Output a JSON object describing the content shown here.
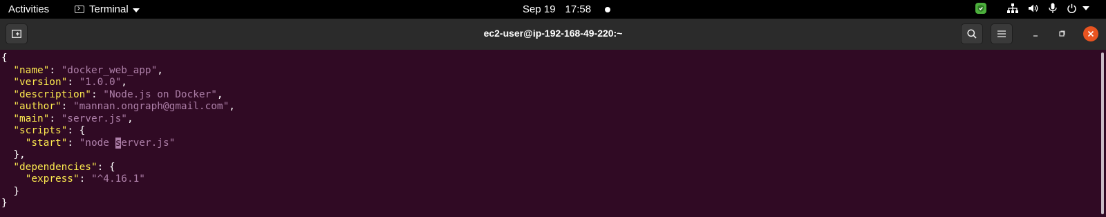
{
  "topbar": {
    "activities": "Activities",
    "app_name": "Terminal",
    "date": "Sep 19",
    "time": "17:58",
    "status_icons": [
      "shield-check-icon",
      "network-icon",
      "volume-icon",
      "microphone-icon",
      "power-icon"
    ]
  },
  "window": {
    "title": "ec2-user@ip-192-168-49-220:~",
    "buttons": [
      "new-tab-icon",
      "search-icon",
      "hamburger-menu-icon",
      "minimize-icon",
      "maximize-icon",
      "close-icon"
    ]
  },
  "colors": {
    "terminal_bg": "#300a24",
    "key": "#fce94f",
    "string": "#ad7fa8",
    "close_button": "#e95420",
    "shield": "#4caf3c"
  },
  "terminal": {
    "l1_open": "{",
    "name": {
      "indent": "  ",
      "key": "\"name\"",
      "sep": ": ",
      "value": "\"docker_web_app\"",
      "end": ","
    },
    "version": {
      "indent": "  ",
      "key": "\"version\"",
      "sep": ": ",
      "value": "\"1.0.0\"",
      "end": ","
    },
    "description": {
      "indent": "  ",
      "key": "\"description\"",
      "sep": ": ",
      "value": "\"Node.js on Docker\"",
      "end": ","
    },
    "author": {
      "indent": "  ",
      "key": "\"author\"",
      "sep": ": ",
      "value": "\"mannan.ongraph@gmail.com\"",
      "end": ","
    },
    "main": {
      "indent": "  ",
      "key": "\"main\"",
      "sep": ": ",
      "value": "\"server.js\"",
      "end": ","
    },
    "scripts": {
      "indent": "  ",
      "key": "\"scripts\"",
      "sep": ": {"
    },
    "start": {
      "indent": "    ",
      "key": "\"start\"",
      "sep": ": ",
      "value_pre": "\"node ",
      "cursor_char": "s",
      "value_post": "erver.js\""
    },
    "scripts_close": "  },",
    "dependencies": {
      "indent": "  ",
      "key": "\"dependencies\"",
      "sep": ": {"
    },
    "express": {
      "indent": "    ",
      "key": "\"express\"",
      "sep": ": ",
      "value": "\"^4.16.1\""
    },
    "deps_close": "  }",
    "close": "}"
  }
}
